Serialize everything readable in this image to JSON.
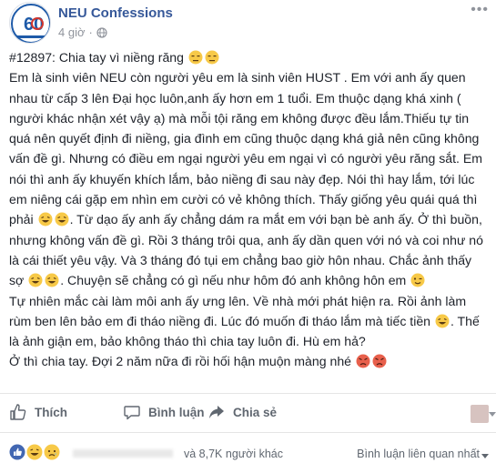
{
  "header": {
    "page_name": "NEU Confessions",
    "time": "4 giờ",
    "avatar_text": "60",
    "icons": {
      "avatar": "page-logo",
      "privacy": "globe-icon",
      "more": "more-options-icon"
    }
  },
  "post": {
    "segments": [
      "#12897: Chia tay vì niềng răng ",
      "\nEm là sinh viên NEU còn người yêu em là sinh viên HUST . Em với anh ấy quen nhau từ cấp 3 lên Đại học luôn,anh ấy hơn em 1 tuổi. Em thuộc dạng khá xinh ( người khác nhận xét vậy ạ) mà mỗi tội răng em không được đều lắm.Thiếu tự tin quá nên quyết định đi niềng, gia đình em cũng thuộc dạng khá giả nên cũng không vấn đề gì. Nhưng có điều em ngại người yêu em ngại vì có người yêu răng sắt. Em nói thì anh ấy khuyến khích lắm, bảo niềng đi sau này đẹp. Nói thì hay lắm, tới lúc em niêng cái gặp em nhìn em cười có vẻ không thích. Thấy giống yêu quái quá thì phải ",
      ". Từ dạo ấy anh ấy chẳng dám ra mắt em với bạn bè anh ấy. Ở thì buồn, nhưng không vấn đề gì. Rồi 3 tháng trôi qua, anh ấy dần quen với nó và coi như nó là cái thiết yêu vậy. Và 3 tháng đó tụi em chẳng bao giờ hôn nhau. Chắc ảnh thấy sợ ",
      ". Chuyện sẽ chẳng có gì nếu như hôm đó anh không hôn em ",
      "\nTự nhiên mắc cài làm môi anh ấy ưng lên. Về nhà mới phát hiện ra. Rồi ảnh làm rùm ben lên bảo em đi tháo niềng đi. Lúc đó muốn đi tháo lắm mà tiếc tiền ",
      ". Thế là ảnh giận em, bảo không tháo thì chia tay luôn đi. Hù em hả?\nỞ thì chia tay. Đợi 2 năm nữa đi rồi hối hận muộn màng nhé "
    ],
    "emoji_names": [
      "unamused-emoji",
      "laughing-emoji",
      "laughing-emoji",
      "wink-emoji",
      "laughing-emoji",
      "angry-emoji"
    ]
  },
  "actions": {
    "like_label": "Thích",
    "comment_label": "Bình luận",
    "share_label": "Chia sẻ"
  },
  "reactions": {
    "icons": [
      "like-reaction-icon",
      "haha-reaction-icon",
      "sad-reaction-icon"
    ],
    "others_text": "và 8,7K người khác",
    "sort_label": "Bình luận liên quan nhất"
  },
  "colors": {
    "link": "#365899",
    "meta": "#90949c",
    "action": "#606770",
    "like_blue": "#4267b2",
    "emoji_yellow": "#f7c948"
  }
}
